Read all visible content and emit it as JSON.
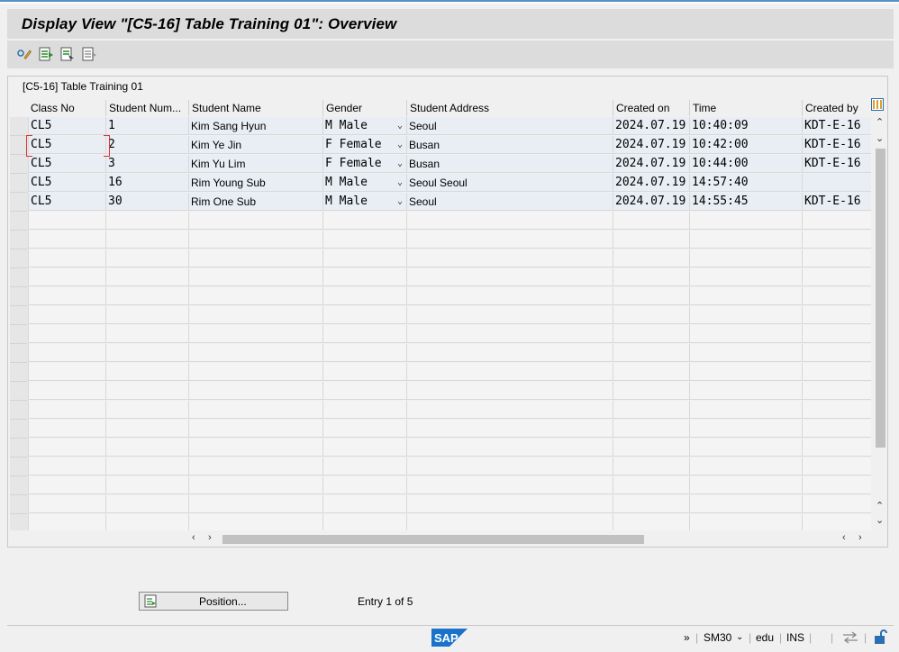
{
  "window": {
    "title": "Display View \"[C5-16] Table Training 01\": Overview"
  },
  "toolbar": {
    "buttons": [
      "display-change-icon",
      "select-all-icon",
      "select-block-icon",
      "deselect-all-icon"
    ]
  },
  "table": {
    "title": "[C5-16] Table Training 01",
    "columns": [
      "Class No",
      "Student Num...",
      "Student Name",
      "Gender",
      "Student Address",
      "Created on",
      "Time",
      "Created by"
    ],
    "rows": [
      {
        "class": "CL5",
        "num": "1",
        "name": "Kim Sang Hyun",
        "gender": "M Male",
        "address": "Seoul",
        "created_on": "2024.07.19",
        "time": "10:40:09",
        "created_by": "KDT-E-16"
      },
      {
        "class": "CL5",
        "num": "2",
        "name": "Kim Ye Jin",
        "gender": "F Female",
        "address": "Busan",
        "created_on": "2024.07.19",
        "time": "10:42:00",
        "created_by": "KDT-E-16"
      },
      {
        "class": "CL5",
        "num": "3",
        "name": "Kim Yu Lim",
        "gender": "F Female",
        "address": "Busan",
        "created_on": "2024.07.19",
        "time": "10:44:00",
        "created_by": "KDT-E-16"
      },
      {
        "class": "CL5",
        "num": "16",
        "name": "Rim Young Sub",
        "gender": "M Male",
        "address": "Seoul Seoul",
        "created_on": "2024.07.19",
        "time": "14:57:40",
        "created_by": ""
      },
      {
        "class": "CL5",
        "num": "30",
        "name": "Rim One Sub",
        "gender": "M Male",
        "address": "Seoul",
        "created_on": "2024.07.19",
        "time": "14:55:45",
        "created_by": "KDT-E-16"
      }
    ]
  },
  "footer": {
    "position_label": "Position...",
    "entry_text": "Entry 1 of 5"
  },
  "statusbar": {
    "nav": "»",
    "tcode": "SM30",
    "user": "edu",
    "mode": "INS"
  },
  "colors": {
    "accent": "#5a8fc8",
    "row_fill": "#e9eef4"
  }
}
